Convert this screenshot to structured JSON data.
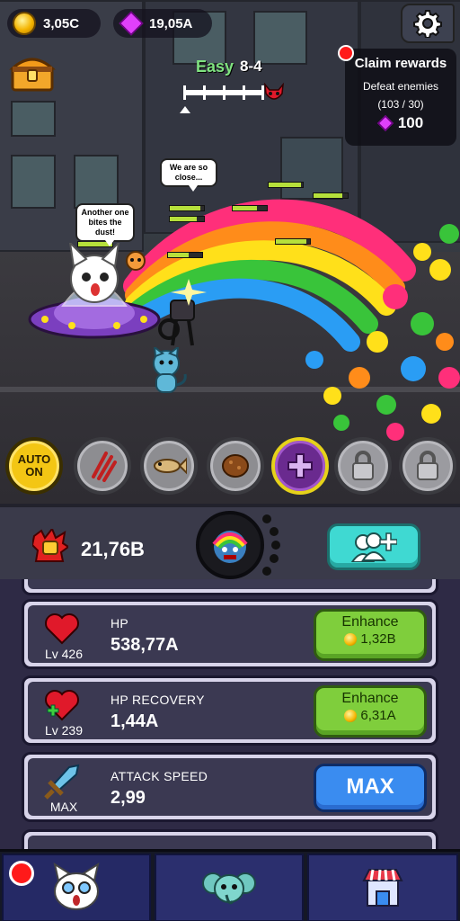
{
  "hud": {
    "gold": "3,05C",
    "gems": "19,05A",
    "settings_icon": "gear-icon",
    "chest_icon": "treasure-chest-icon"
  },
  "stage": {
    "difficulty": "Easy",
    "level": "8-4",
    "boss_icon": "devil-skull-icon"
  },
  "quest": {
    "title": "Claim rewards",
    "task": "Defeat enemies",
    "progress": "(103 / 30)",
    "reward": "100"
  },
  "speech": {
    "enemy": "We are so close...",
    "cat": "Another one bites the dust!"
  },
  "skills": {
    "auto_label_1": "AUTO",
    "auto_label_2": "ON",
    "icons": [
      "claw-scratch-icon",
      "fish-bone-icon",
      "meatball-icon",
      "plus-icon",
      "lock-icon",
      "lock-icon"
    ]
  },
  "stats": {
    "dps": "21,76B",
    "friend_icon": "add-friend-icon"
  },
  "upgrades": [
    {
      "name": "HP",
      "level": "Lv 426",
      "value": "538,77A",
      "button": "Enhance",
      "cost": "1,32B",
      "icon": "heart-icon"
    },
    {
      "name": "HP RECOVERY",
      "level": "Lv 239",
      "value": "1,44A",
      "button": "Enhance",
      "cost": "6,31A",
      "icon": "heart-plus-icon"
    },
    {
      "name": "ATTACK SPEED",
      "level": "MAX",
      "value": "2,99",
      "button": "MAX",
      "icon": "sword-icon"
    }
  ],
  "nav": {
    "tabs": [
      "cat-tab",
      "pet-tab",
      "shop-tab"
    ]
  },
  "colors": {
    "gold": "#f4b400",
    "gem": "#e040fb",
    "enhance_green": "#7fce3c",
    "max_blue": "#3a8cf0",
    "friend_cyan": "#3fd9d2"
  }
}
